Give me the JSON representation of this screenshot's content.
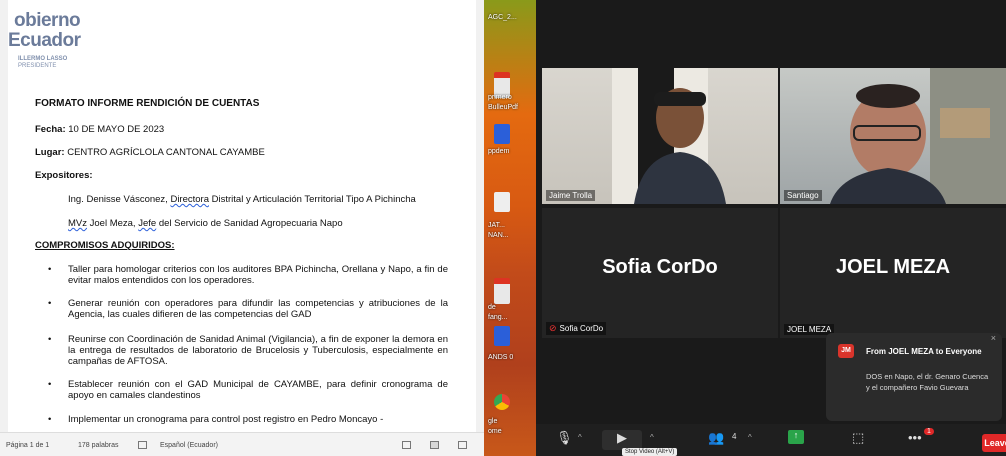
{
  "document": {
    "logo_line1": "obierno",
    "logo_line2": "Ecuador",
    "logo_line3": "ILLERMO LASSO",
    "logo_line4": "PRESIDENTE",
    "title": "FORMATO INFORME RENDICIÓN DE CUENTAS",
    "fecha_label": "Fecha:",
    "fecha_value": "10 DE MAYO DE  2023",
    "lugar_label": "Lugar:",
    "lugar_value": "CENTRO AGRÍCLOLA CANTONAL CAYAMBE",
    "expositores_label": "Expositores:",
    "expositor1_a": "Ing.  Denisse Vásconez, ",
    "expositor1_b": "Directora",
    "expositor1_c": " Distrital y Articulación Territorial Tipo A Pichincha",
    "expositor2_a": "MVz",
    "expositor2_b": " Joel Meza, ",
    "expositor2_c": "Jefe",
    "expositor2_d": " del Servicio de Sanidad Agropecuaria Napo",
    "compromisos_heading": "COMPROMISOS ADQUIRIDOS:",
    "bullets": [
      "Taller para homologar criterios con los auditores BPA Pichincha, Orellana y Napo, a fin de evitar malos entendidos con los operadores.",
      "Generar reunión con operadores para difundir las competencias y atribuciones de la Agencia, las cuales difieren de las competencias del GAD",
      "Reunirse con Coordinación de Sanidad Animal (Vigilancia), a fin de exponer la demora en la entrega de resultados de laboratorio de Brucelosis y Tuberculosis, especialmente en campañas de AFTOSA.",
      "Establecer reunión con el GAD Municipal de CAYAMBE, para definir cronograma de apoyo en camales clandestinos",
      "Implementar un cronograma para control post registro en Pedro Moncayo -"
    ],
    "bullet_char": "•"
  },
  "statusbar": {
    "page": "Página 1 de 1",
    "words": "178 palabras",
    "language": "Español (Ecuador)"
  },
  "desktop": {
    "labels": [
      "AGC_2...",
      "primero",
      "BulleuPdf",
      "ppdem",
      "JAT...",
      "NAN...",
      "de",
      "fang...",
      "ANDS 0",
      "gle",
      "ome"
    ],
    "pdf_label": "PDF"
  },
  "zoom": {
    "participants": [
      {
        "name": "Jaime Trolla",
        "video": true,
        "active": true
      },
      {
        "name": "Santiago",
        "video": true,
        "active": false
      },
      {
        "name": "Sofia CorDo",
        "video": false,
        "muted": true
      },
      {
        "name": "JOEL MEZA",
        "video": false,
        "muted": false
      }
    ],
    "chat": {
      "avatar": "JM",
      "from": "From JOEL MEZA to Everyone",
      "message": "DOS en Napo, el dr. Genaro Cuenca y el compañero Favio Guevara",
      "close": "×"
    },
    "toolbar": {
      "participants_count": "4",
      "more_badge": "1",
      "tooltip": "Stop Video (Alt+V)",
      "leave": "Leave"
    },
    "colors": {
      "active_border": "#cfd64a",
      "leave": "#e02828",
      "mute_red": "#e33333"
    }
  }
}
